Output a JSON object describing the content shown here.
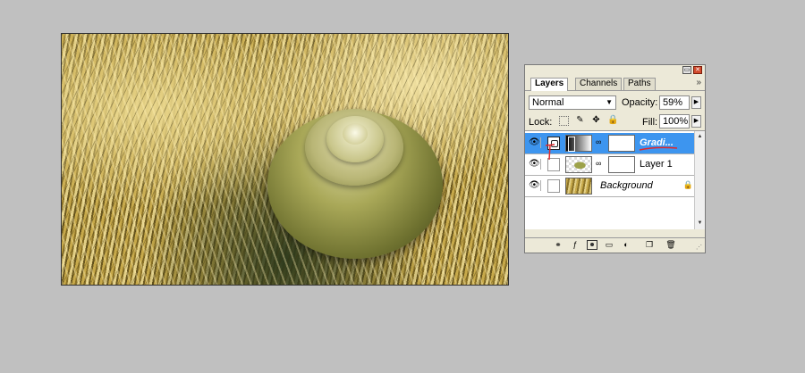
{
  "document": {
    "icons": [
      "snail-shell",
      "wheat-field"
    ]
  },
  "layers_panel": {
    "tabs": [
      {
        "label": "Layers",
        "active": true
      },
      {
        "label": "Channels",
        "active": false
      },
      {
        "label": "Paths",
        "active": false
      }
    ],
    "menu_icon": "»",
    "blend_mode": "Normal",
    "opacity_label": "Opacity:",
    "opacity_value": "59%",
    "lock_label": "Lock:",
    "fill_label": "Fill:",
    "fill_value": "100%",
    "layers": [
      {
        "name": "Gradi...",
        "selected": true,
        "type": "adjustment-gradient"
      },
      {
        "name": "Layer 1",
        "selected": false,
        "type": "pixel"
      },
      {
        "name": "Background",
        "selected": false,
        "type": "background",
        "locked": true
      }
    ],
    "colors": {
      "selected_row": "#3d95ef",
      "annotation": "#e0282c"
    }
  }
}
